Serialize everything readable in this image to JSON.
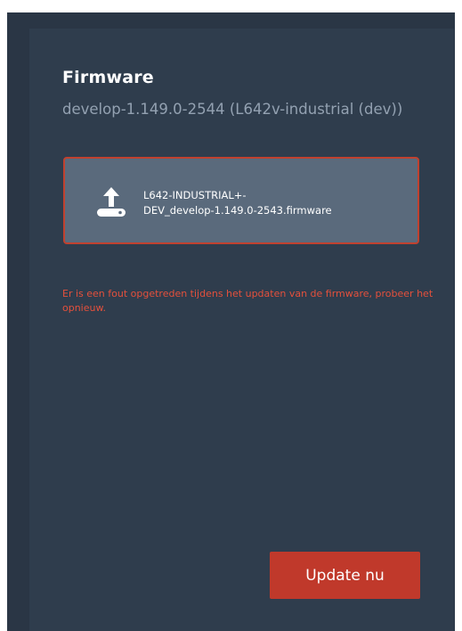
{
  "firmware": {
    "title": "Firmware",
    "current_version": "develop-1.149.0-2544 (L642v-industrial (dev))",
    "upload": {
      "icon": "upload-icon",
      "file_name_line1": "L642-INDUSTRIAL+-",
      "file_name_line2": "DEV_develop-1.149.0-2543.firmware"
    },
    "error_message": "Er is een fout opgetreden tijdens het updaten van de firmware, probeer het opnieuw.",
    "update_button_label": "Update nu"
  },
  "colors": {
    "panel_background": "#2f3d4d",
    "upload_box_background": "#5a6a7c",
    "error_border": "#c0412f",
    "error_text": "#e4503c",
    "button_background": "#c0392b",
    "subtitle_text": "#93a1b1"
  }
}
